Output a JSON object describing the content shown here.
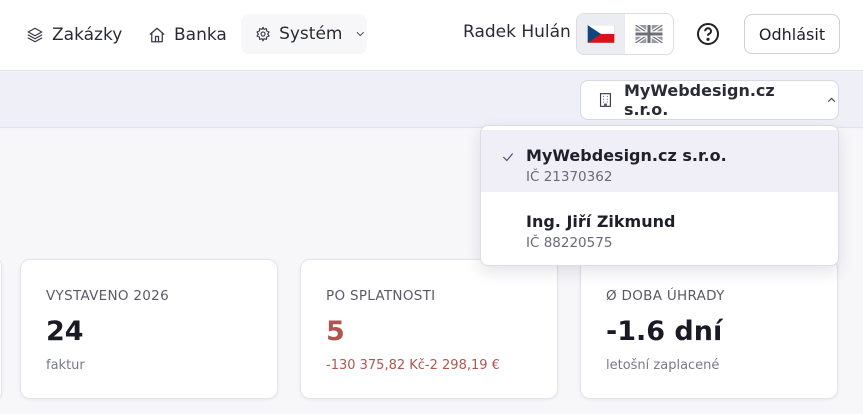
{
  "nav": {
    "items": [
      {
        "label": "Zakázky",
        "icon": "layers-icon"
      },
      {
        "label": "Banka",
        "icon": "home-icon"
      },
      {
        "label": "Systém",
        "icon": "gear-icon"
      }
    ],
    "user_name": "Radek Hulán",
    "languages": [
      {
        "code": "cs",
        "icon": "czech-flag-icon",
        "active": true
      },
      {
        "code": "en",
        "icon": "uk-flag-icon",
        "active": false
      }
    ],
    "help_icon": "question-circle-icon",
    "logout_label": "Odhlásit"
  },
  "company_selector": {
    "selected": "MyWebdesign.cz s.r.o.",
    "icon": "building-icon",
    "options": [
      {
        "name": "MyWebdesign.cz s.r.o.",
        "ic": "IČ 21370362",
        "selected": true
      },
      {
        "name": "Ing. Jiří Zikmund",
        "ic": "IČ 88220575",
        "selected": false
      }
    ]
  },
  "stats": [
    {
      "label": "VYSTAVENO 2026",
      "value": "24",
      "sub": "faktur"
    },
    {
      "label": "PO SPLATNOSTI",
      "value": "5",
      "sub": "-130 375,82 Kč-2 298,19 €"
    },
    {
      "label": "Ø DOBA ÚHRADY",
      "value": "-1.6 dní",
      "sub": "letošní zaplacené"
    }
  ],
  "colors": {
    "accent_dark": "#2b2b36",
    "overdue_red": "#b0564f",
    "selected_bg": "#f0eff8"
  }
}
